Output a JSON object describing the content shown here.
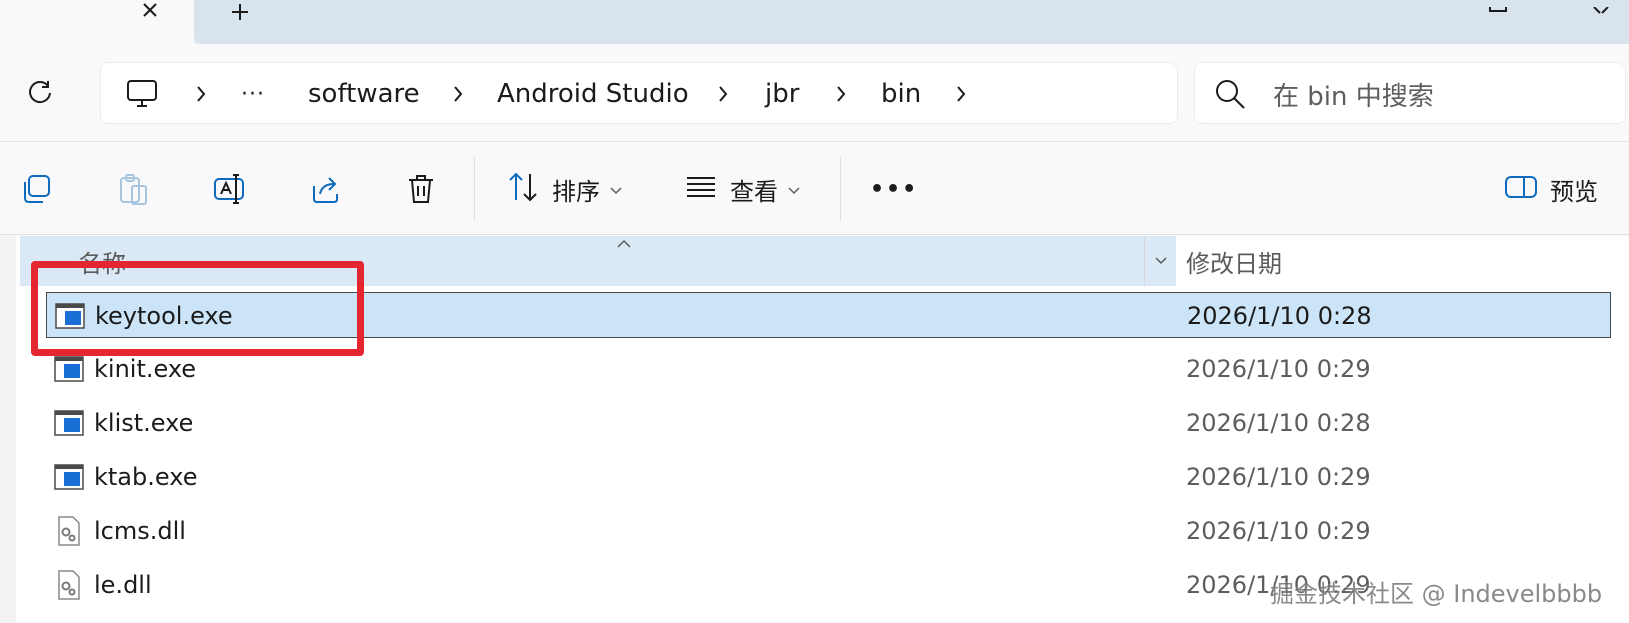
{
  "breadcrumb": {
    "overflow": "···",
    "items": [
      "software",
      "Android Studio",
      "jbr",
      "bin"
    ]
  },
  "search": {
    "placeholder": "在 bin 中搜索"
  },
  "commandbar": {
    "sort_label": "排序",
    "view_label": "查看",
    "more": "•••",
    "preview_label": "预览"
  },
  "columns": {
    "name": "名称",
    "date": "修改日期"
  },
  "files": [
    {
      "name": "keytool.exe",
      "date": "2026/1/10 0:28",
      "type": "exe",
      "selected": true
    },
    {
      "name": "kinit.exe",
      "date": "2026/1/10 0:29",
      "type": "exe"
    },
    {
      "name": "klist.exe",
      "date": "2026/1/10 0:28",
      "type": "exe"
    },
    {
      "name": "ktab.exe",
      "date": "2026/1/10 0:29",
      "type": "exe"
    },
    {
      "name": "lcms.dll",
      "date": "2026/1/10 0:29",
      "type": "dll"
    },
    {
      "name": "le.dll",
      "date": "2026/1/10 0:29",
      "type": "dll"
    }
  ],
  "watermark": "掘金技术社区 @ Indevelbbbb",
  "icons": {
    "tab_close": "close-icon",
    "tab_new": "plus-icon",
    "refresh": "refresh-icon",
    "computer": "computer-icon",
    "search": "search-icon",
    "copy": "copy-icon",
    "paste": "paste-icon",
    "rename": "rename-icon",
    "share": "share-icon",
    "delete": "trash-icon",
    "sort": "sort-icon",
    "view": "view-icon",
    "preview": "preview-pane-icon"
  },
  "colors": {
    "selection": "#cce4f7",
    "annotation": "#e3262f",
    "header_bg": "#dbe8f5"
  }
}
